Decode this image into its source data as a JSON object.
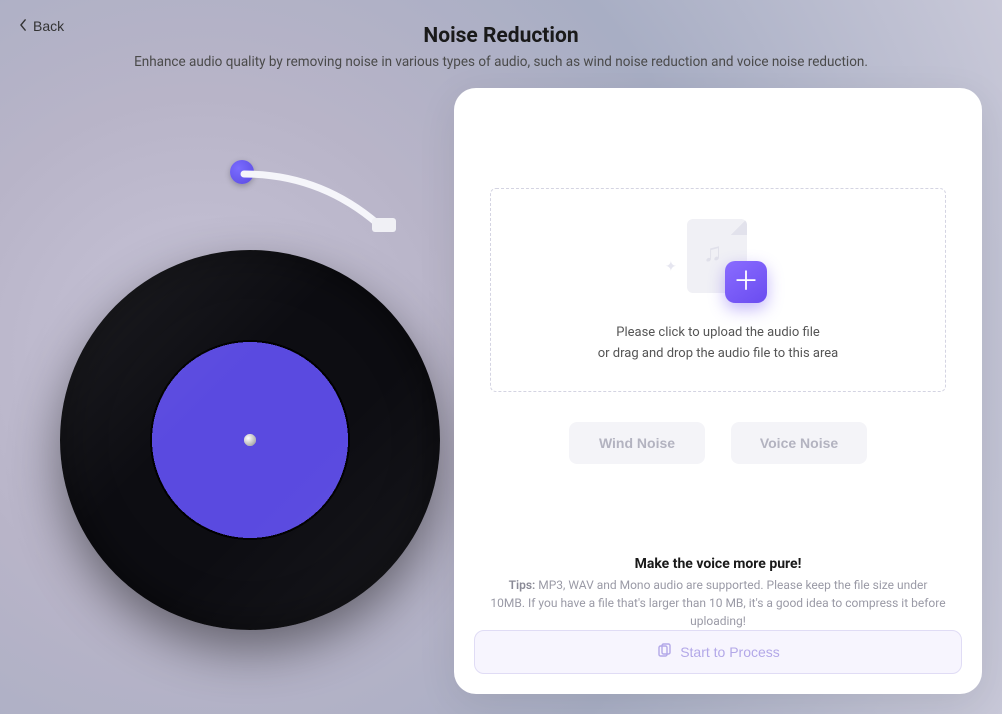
{
  "nav": {
    "back_label": "Back"
  },
  "header": {
    "title": "Noise Reduction",
    "subtitle": "Enhance audio quality by removing noise in various types of audio, such as wind noise reduction and voice noise reduction."
  },
  "dropzone": {
    "line1": "Please click to upload the audio file",
    "line2": "or drag and drop the audio file to this area"
  },
  "modes": {
    "wind": "Wind Noise",
    "voice": "Voice Noise"
  },
  "tips": {
    "headline": "Make the voice more pure!",
    "label": "Tips:",
    "body": " MP3, WAV and Mono audio are supported. Please keep the file size under 10MB. If you have a file that's larger than 10 MB, it's a good idea to compress it before uploading!"
  },
  "actions": {
    "process": "Start to Process"
  }
}
